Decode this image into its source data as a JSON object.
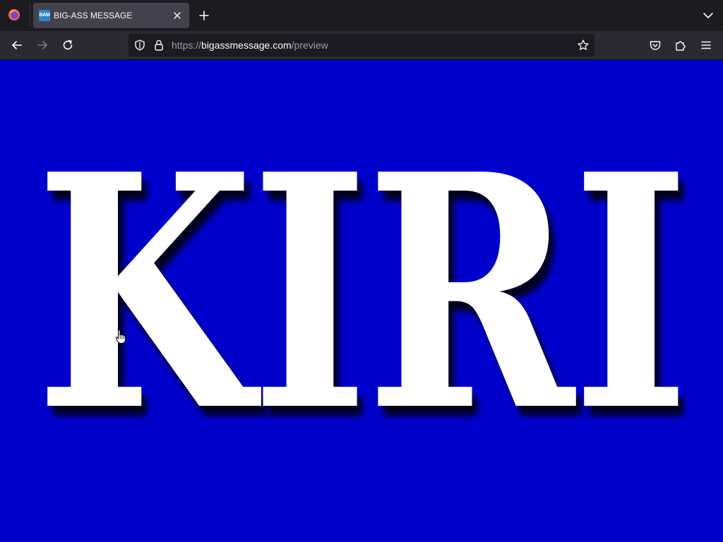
{
  "browser": {
    "tab": {
      "favicon_text": "BAM",
      "title": "BIG-ASS MESSAGE"
    },
    "url": {
      "scheme": "https://",
      "domain": "bigassmessage.com",
      "path": "/preview"
    },
    "icons": {
      "browser_logo": "firefox-logo-icon",
      "tab_close": "close-icon",
      "new_tab": "plus-icon",
      "tab_list": "chevron-down-icon",
      "back": "arrow-left-icon",
      "forward": "arrow-right-icon",
      "reload": "reload-icon",
      "tracking_protection": "shield-icon",
      "security": "lock-icon",
      "bookmark": "star-icon",
      "pocket": "pocket-icon",
      "extensions": "puzzle-icon",
      "menu": "hamburger-menu-icon"
    }
  },
  "page": {
    "message": "KIRI",
    "background_color": "#0000cd",
    "text_color": "#ffffff"
  }
}
